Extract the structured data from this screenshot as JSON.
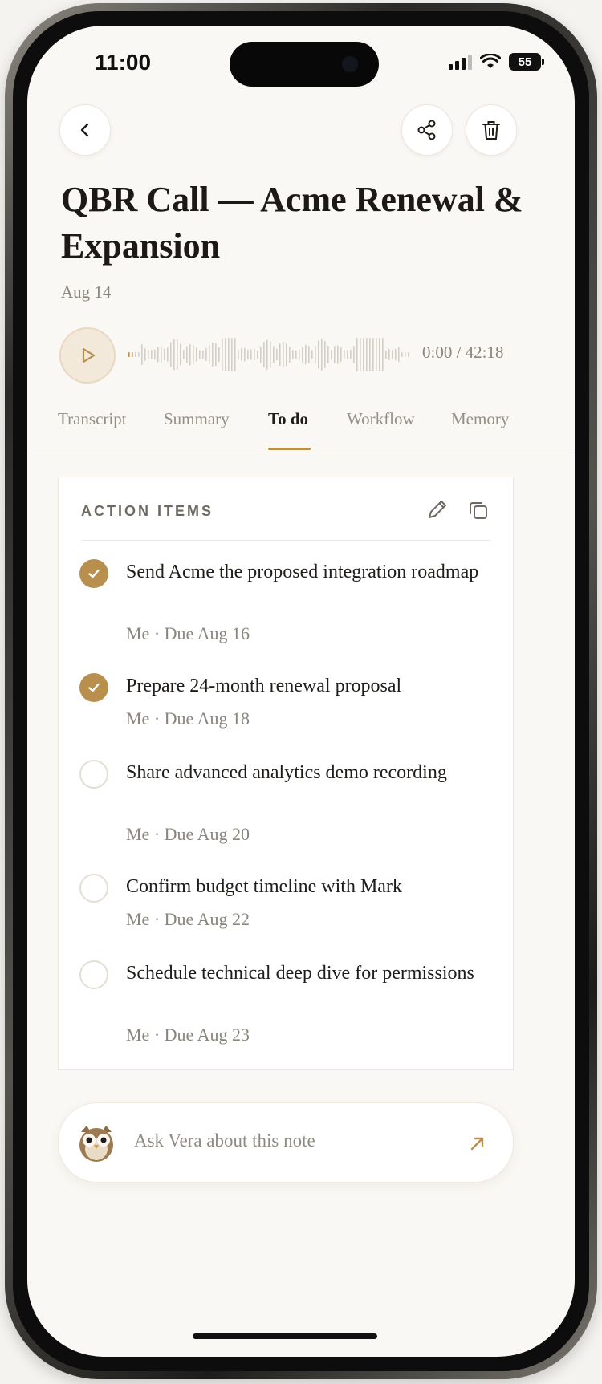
{
  "status_bar": {
    "time": "11:00",
    "battery": "55"
  },
  "note": {
    "title": "QBR Call — Acme Renewal & Expansion",
    "date": "Aug 14"
  },
  "player": {
    "time_readout": "0:00 / 42:18",
    "progress": 0
  },
  "tabs": [
    {
      "label": "Transcript",
      "active": false
    },
    {
      "label": "Summary",
      "active": false
    },
    {
      "label": "To do",
      "active": true
    },
    {
      "label": "Workflow",
      "active": false
    },
    {
      "label": "Memory",
      "active": false
    }
  ],
  "action_items": {
    "header": "ACTION ITEMS",
    "items": [
      {
        "text": "Send Acme the proposed integration roadmap",
        "meta": "Me · Due Aug 16",
        "done": true
      },
      {
        "text": "Prepare 24-month renewal proposal",
        "meta": "Me · Due Aug 18",
        "done": true
      },
      {
        "text": "Share advanced analytics demo recording",
        "meta": "Me · Due Aug 20",
        "done": false
      },
      {
        "text": "Confirm budget timeline with Mark",
        "meta": "Me · Due Aug 22",
        "done": false
      },
      {
        "text": "Schedule technical deep dive for permissions",
        "meta": "Me · Due Aug 23",
        "done": false
      }
    ]
  },
  "ask_bar": {
    "placeholder": "Ask Vera about this note"
  },
  "icons": {
    "back": "chevron-left-icon",
    "share": "share-icon",
    "delete": "trash-icon",
    "play": "play-icon",
    "edit": "pencil-icon",
    "copy": "copy-icon",
    "assistant": "owl-avatar-icon",
    "send": "arrow-up-right-icon"
  },
  "colors": {
    "accent": "#b88f4d",
    "background": "#faf8f4",
    "muted_text": "#8a857d"
  }
}
